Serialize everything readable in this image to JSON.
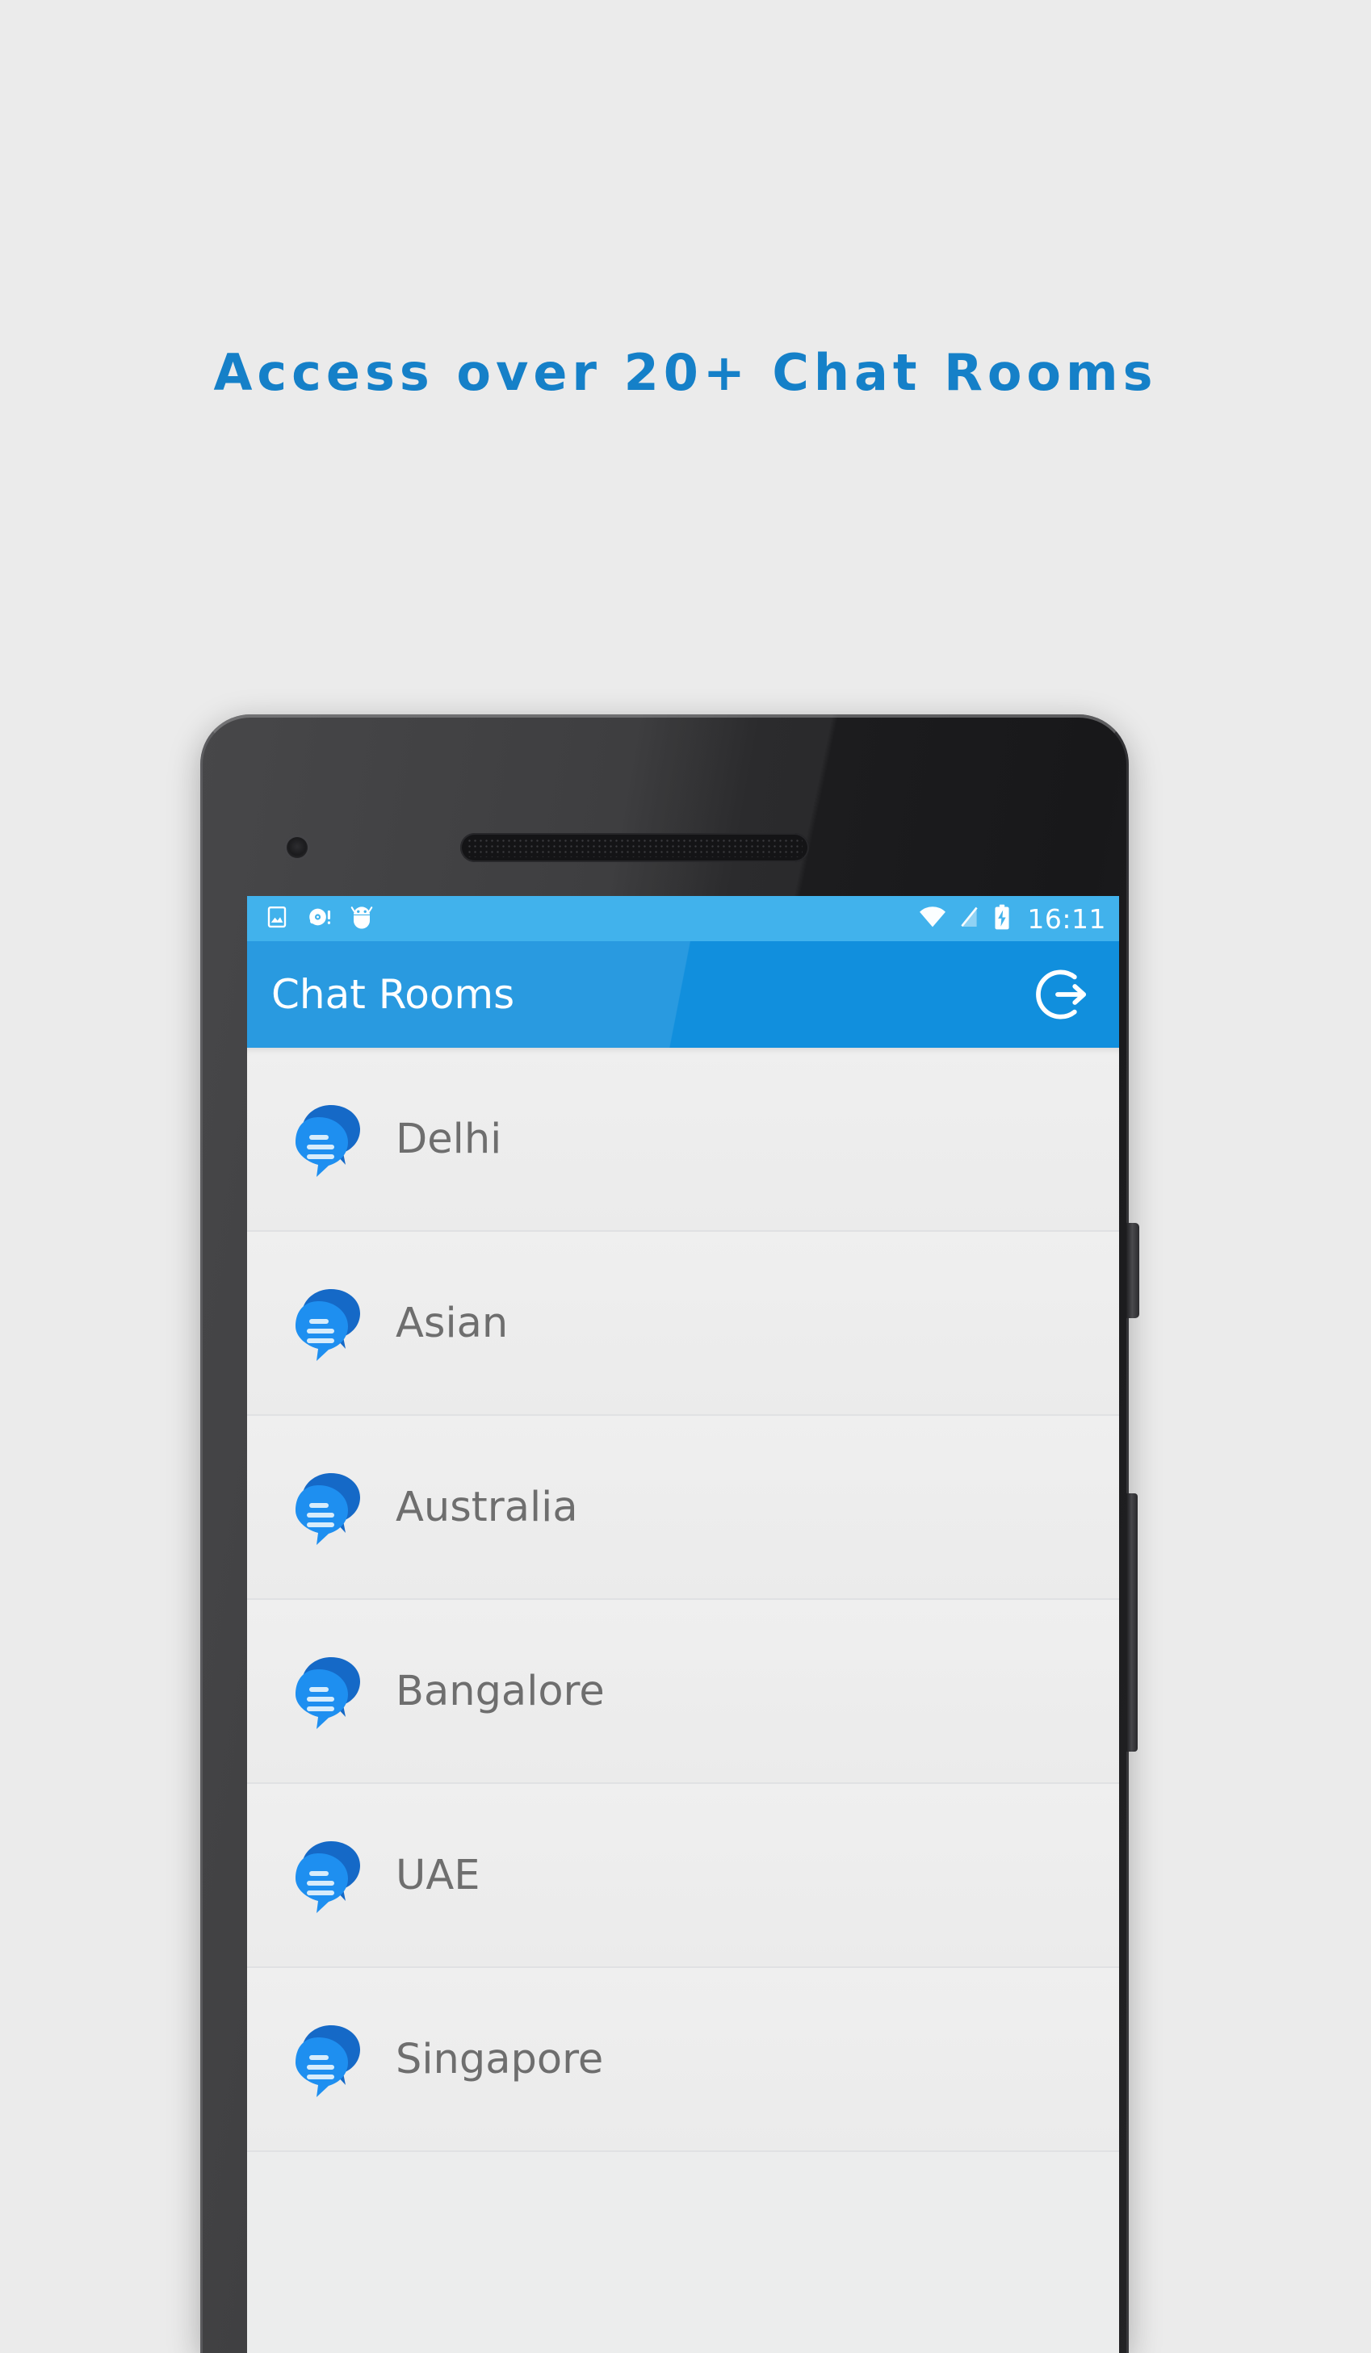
{
  "promo": {
    "headline": "Access  over  20+  Chat  Rooms",
    "headline_color": "#1580c8",
    "background_color": "#ebebeb"
  },
  "phone": {
    "device_parts": {
      "camera": "front-camera",
      "speaker": "earpiece-speaker",
      "power_button": "power-button",
      "volume_button": "volume-rocker"
    }
  },
  "screen": {
    "statusbar": {
      "background_color": "#41b2ec",
      "left_icons": [
        "screenshot-icon",
        "disc-alert-icon",
        "android-debug-icon"
      ],
      "right_icons": [
        "wifi-icon",
        "signal-off-icon",
        "battery-charging-icon"
      ],
      "time": "16:11"
    },
    "appbar": {
      "title": "Chat Rooms",
      "background_color": "#118fdd",
      "text_color": "#ffffff",
      "action_icon": "logout-icon"
    },
    "rooms": [
      {
        "name": "Delhi",
        "icon": "chat-bubbles-icon"
      },
      {
        "name": "Asian",
        "icon": "chat-bubbles-icon"
      },
      {
        "name": "Australia",
        "icon": "chat-bubbles-icon"
      },
      {
        "name": "Bangalore",
        "icon": "chat-bubbles-icon"
      },
      {
        "name": "UAE",
        "icon": "chat-bubbles-icon"
      },
      {
        "name": "Singapore",
        "icon": "chat-bubbles-icon"
      }
    ],
    "list_text_color": "#6e6e6e",
    "list_background_color": "#eceded"
  }
}
